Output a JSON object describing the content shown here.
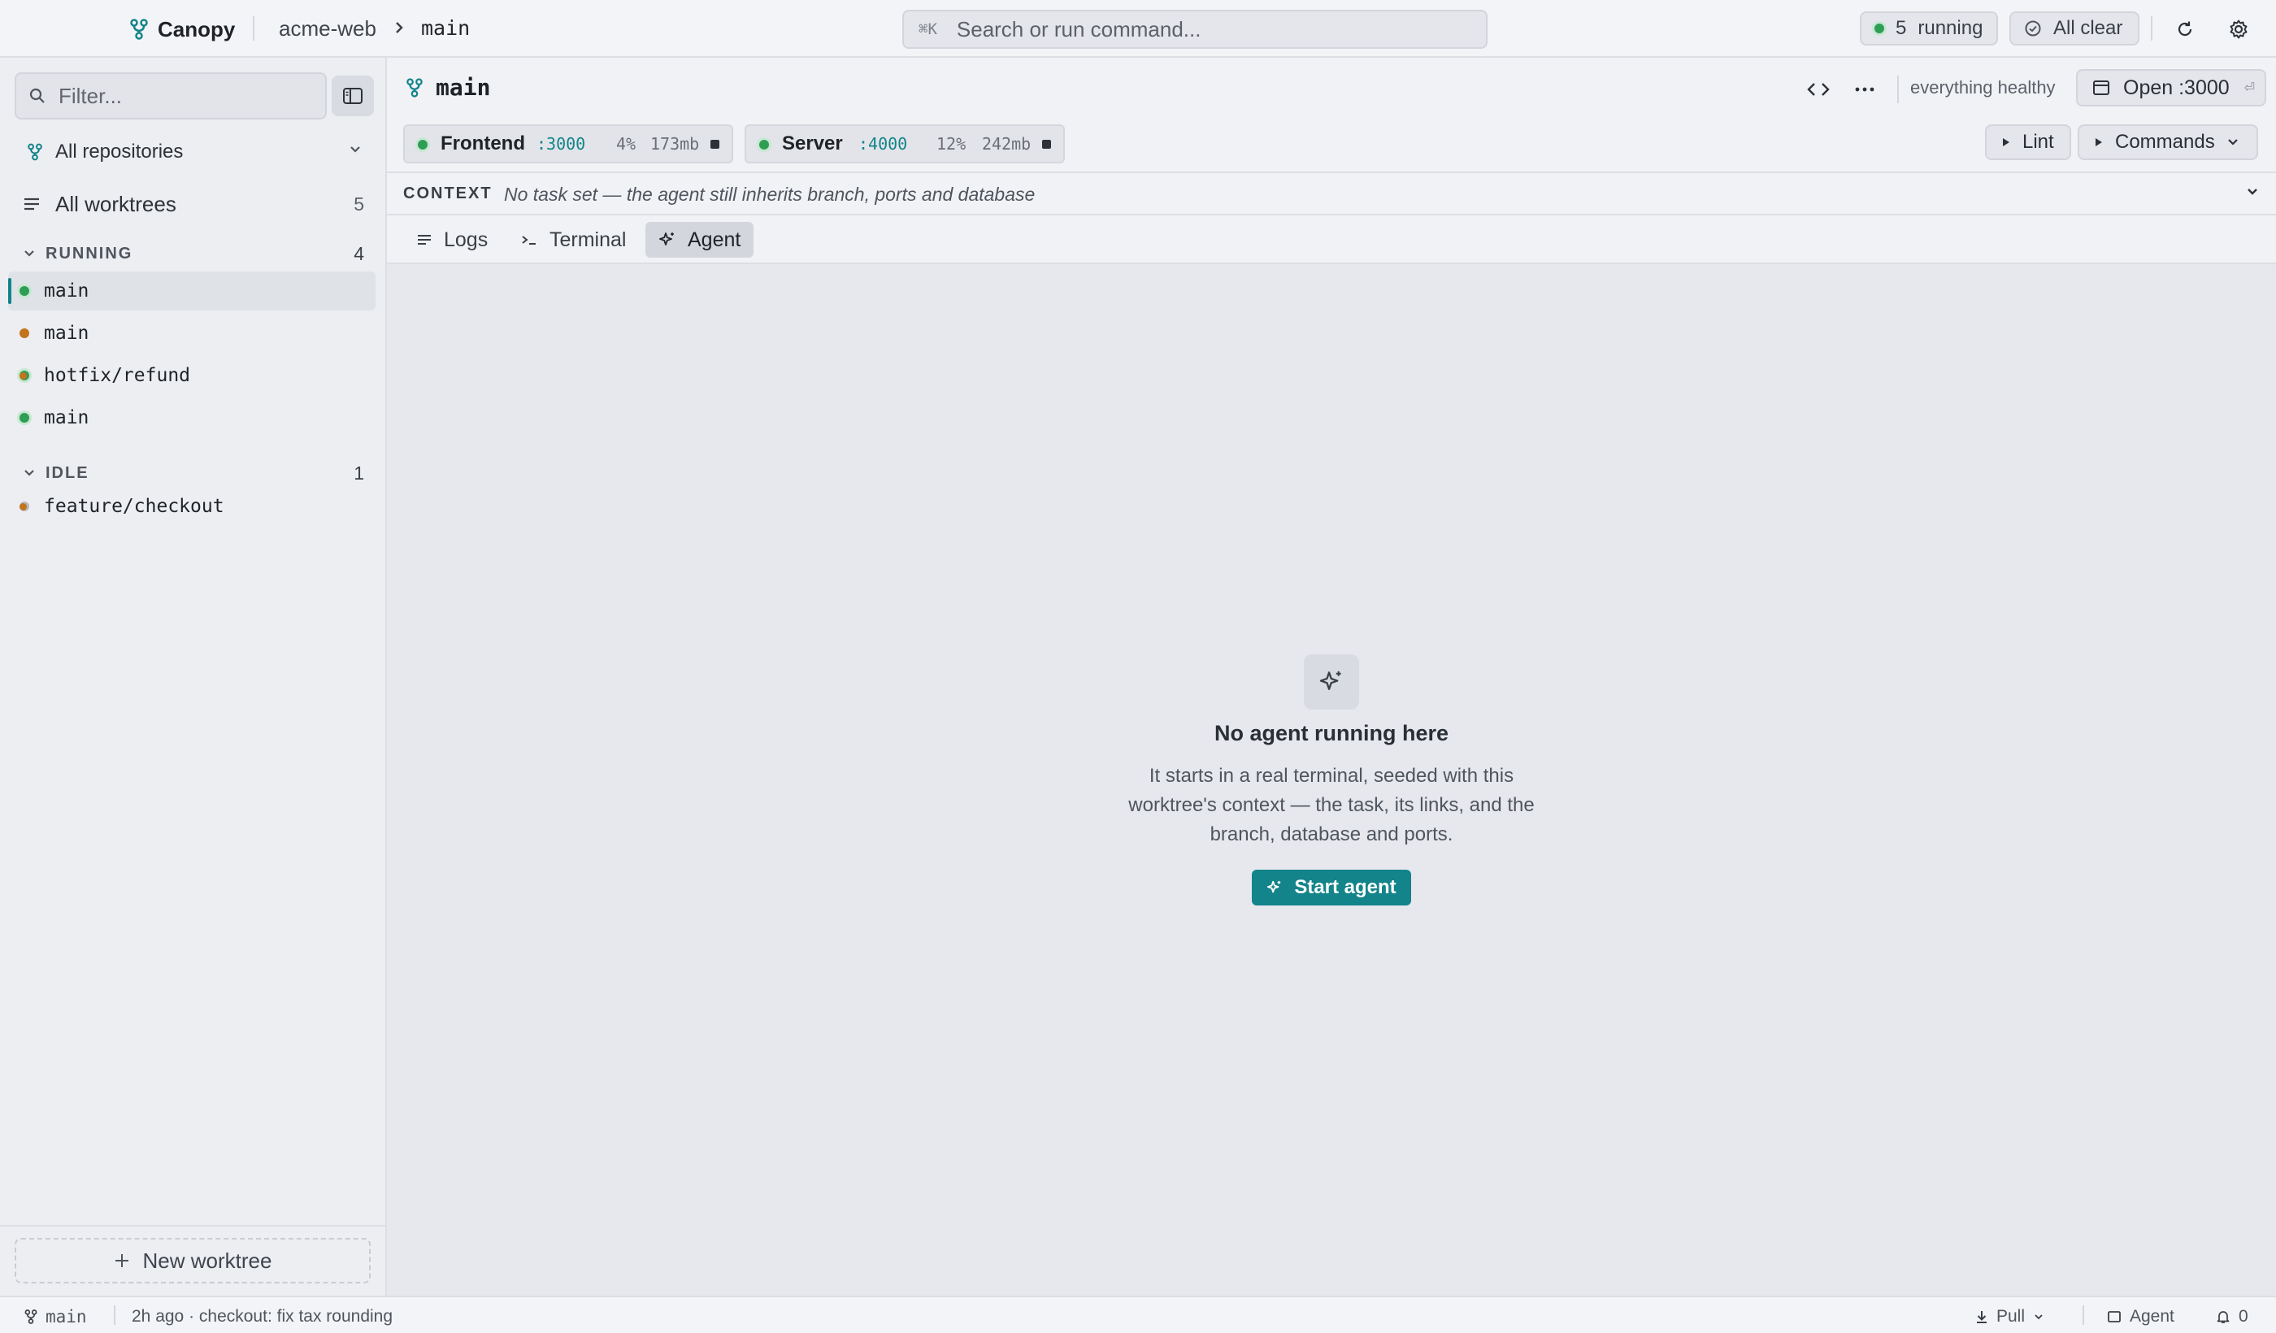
{
  "topbar": {
    "app_name": "Canopy",
    "repo": "acme-web",
    "branch": "main",
    "search_placeholder": "Search or run command...",
    "search_shortcut": "⌘K",
    "running_count": "5",
    "running_label": "running",
    "status_label": "All clear"
  },
  "sidebar": {
    "filter_placeholder": "Filter...",
    "repo_select": "All repositories",
    "all_worktrees_label": "All worktrees",
    "all_worktrees_count": "5",
    "groups": [
      {
        "label": "RUNNING",
        "count": "4",
        "items": [
          {
            "name": "main",
            "status": "running",
            "active": true,
            "dirty": false
          },
          {
            "name": "main",
            "status": "starting",
            "active": false,
            "dirty": false
          },
          {
            "name": "hotfix/refund",
            "status": "running",
            "active": false,
            "dirty": true
          },
          {
            "name": "main",
            "status": "running",
            "active": false,
            "dirty": false
          }
        ]
      },
      {
        "label": "IDLE",
        "count": "1",
        "items": [
          {
            "name": "feature/checkout",
            "status": "idle",
            "active": false,
            "dirty": true
          }
        ]
      }
    ],
    "new_worktree_label": "New worktree"
  },
  "main": {
    "title": "main",
    "health": "everything healthy",
    "open_label": "Open :3000",
    "processes": [
      {
        "name": "Frontend",
        "port": ":3000",
        "cpu": "4%",
        "mem": "173mb"
      },
      {
        "name": "Server",
        "port": ":4000",
        "cpu": "12%",
        "mem": "242mb"
      }
    ],
    "lint_label": "Lint",
    "commands_label": "Commands",
    "context_label": "CONTEXT",
    "context_text": "No task set — the agent still inherits branch, ports and database",
    "tabs": [
      "Logs",
      "Terminal",
      "Agent"
    ],
    "active_tab": "Agent",
    "empty_title": "No agent running here",
    "empty_desc": [
      "It starts in a real terminal, seeded with this",
      "worktree's context — the task, its links, and the",
      "branch, database and ports."
    ],
    "start_label": "Start agent"
  },
  "statusbar": {
    "branch": "main",
    "last_commit": "2h ago · checkout: fix tax rounding",
    "pull_label": "Pull",
    "agent_label": "Agent",
    "notifications": "0"
  },
  "colors": {
    "accent": "#12848a",
    "running": "#2f9e55",
    "starting": "#c2731c",
    "idle": "#b5b9c0"
  }
}
